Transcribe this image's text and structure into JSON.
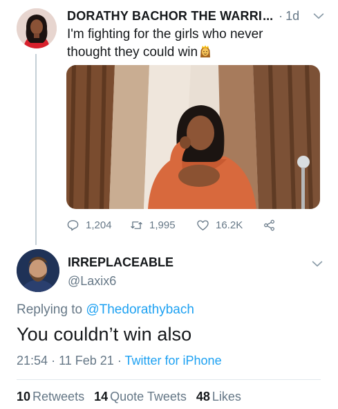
{
  "parent_tweet": {
    "display_name": "DORATHY BACHOR THE WARRI",
    "ellipsis": "...",
    "separator": "·",
    "time": "1d",
    "text": "I'm fighting for the girls who never thought they could win",
    "emoji_icon": "princess-emoji-icon",
    "actions": {
      "reply_count": "1,204",
      "retweet_count": "1,995",
      "like_count": "16.2K"
    }
  },
  "main_tweet": {
    "display_name": "IRREPLACEABLE",
    "handle": "@Laxix6",
    "replying_prefix": "Replying to ",
    "replying_to": "@Thedorathybach",
    "text": "You couldn’t win also",
    "time": "21:54",
    "sep1": "·",
    "date": "11 Feb 21",
    "sep2": "·",
    "source": "Twitter for iPhone",
    "stats": {
      "retweets_count": "10",
      "retweets_label": "Retweets",
      "quotes_count": "14",
      "quotes_label": "Quote Tweets",
      "likes_count": "48",
      "likes_label": "Likes"
    }
  },
  "colors": {
    "accent": "#1da1f2",
    "secondary_text": "#657786",
    "primary_text": "#14171a"
  }
}
